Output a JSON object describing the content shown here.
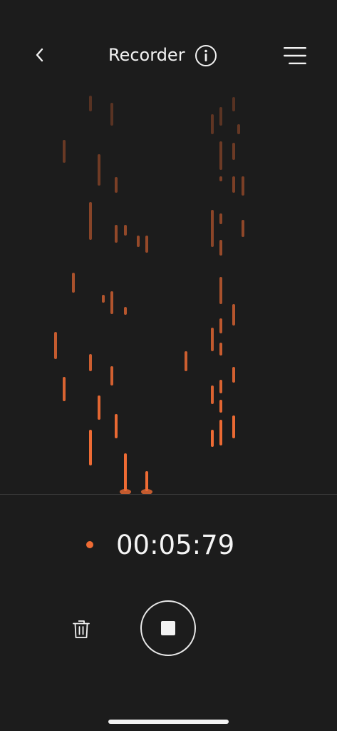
{
  "header": {
    "back_icon": "chevron-left-icon",
    "title": "Recorder",
    "info_icon": "info-icon",
    "menu_icon": "hamburger-menu-icon"
  },
  "recording": {
    "timer": "00:05:79",
    "status_color": "#ee6b34"
  },
  "controls": {
    "delete_icon": "trash-icon",
    "stop_icon": "stop-icon"
  },
  "colors": {
    "background": "#1c1c1c",
    "accent": "#ee6b34",
    "text": "#f5f5f5"
  }
}
